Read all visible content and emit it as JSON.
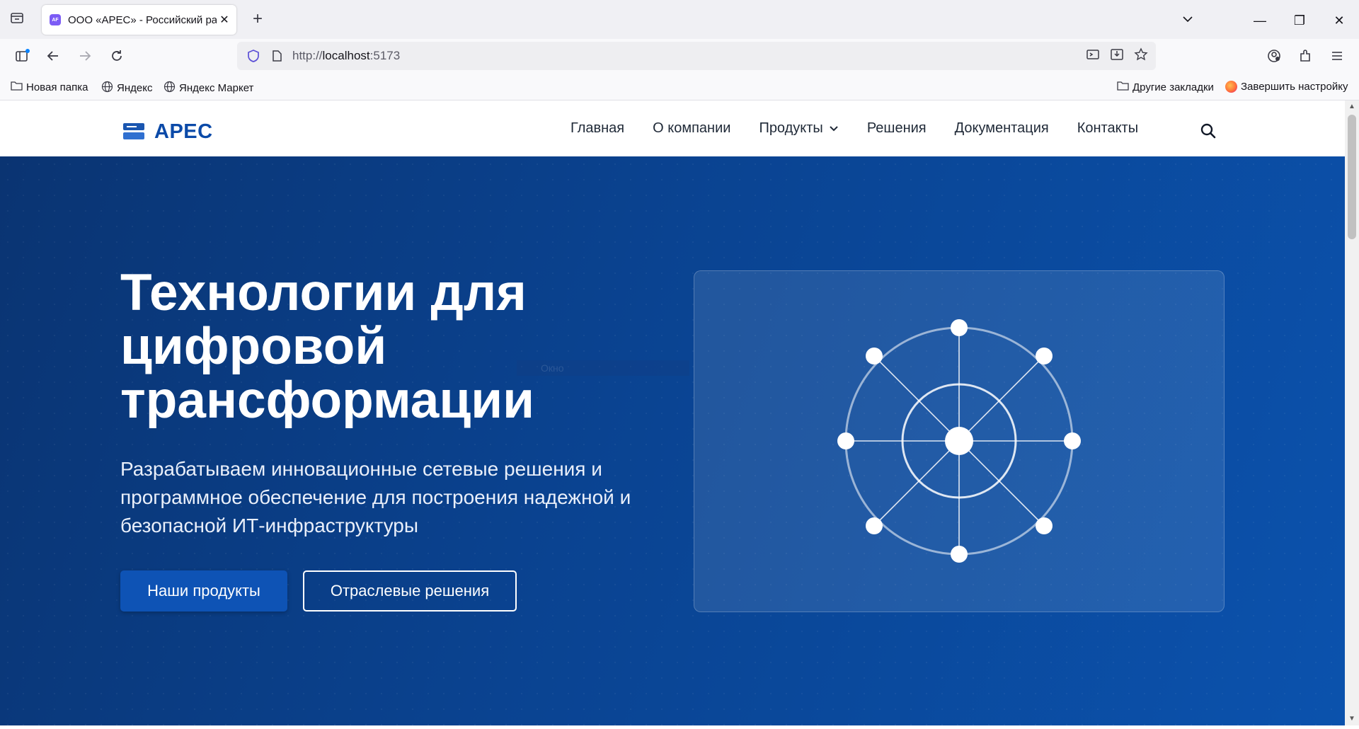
{
  "browser": {
    "tab": {
      "favicon_text": "AF",
      "title": "ООО «АРЕС» - Российский разработчик",
      "close_glyph": "✕"
    },
    "new_tab_glyph": "+",
    "window_controls": {
      "list_glyph": "⌄",
      "minimize": "—",
      "restore": "❐",
      "close": "✕"
    },
    "address": {
      "protocol": "http://",
      "host": "localhost",
      "port": ":5173"
    },
    "bookmarks": [
      {
        "label": "Новая папка"
      },
      {
        "label": "Яндекс"
      },
      {
        "label": "Яндекс Маркет"
      }
    ],
    "bookmarks_right": [
      {
        "label": "Другие закладки"
      },
      {
        "label": "Завершить настройку"
      }
    ]
  },
  "site": {
    "logo_text": "АРЕС",
    "nav": [
      {
        "label": "Главная"
      },
      {
        "label": "О компании"
      },
      {
        "label": "Продукты"
      },
      {
        "label": "Решения"
      },
      {
        "label": "Документация"
      },
      {
        "label": "Контакты"
      }
    ]
  },
  "hero": {
    "title": "Технологии для цифровой трансформации",
    "subtitle": "Разрабатываем инновационные сетевые решения и программное обеспечение для построения надежной и безопасной ИТ-инфраструктуры",
    "primary_button": "Наши продукты",
    "secondary_button": "Отраслевые решения",
    "ghost_label": "Окно"
  },
  "colors": {
    "brand": "#0b4aa8",
    "hero_start": "#0a3472",
    "hero_end": "#0b52ad",
    "button_primary": "#0e53b5"
  }
}
